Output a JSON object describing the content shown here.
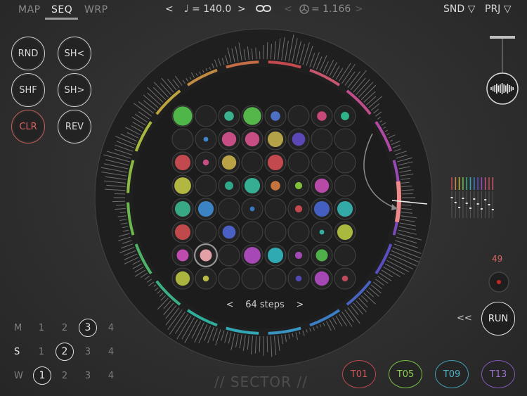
{
  "tabs": {
    "map": "MAP",
    "seq": "SEQ",
    "wrp": "WRP"
  },
  "tempo": {
    "prev": "<",
    "value": "♩ = 140.0",
    "next": ">"
  },
  "swing": {
    "prev": "<",
    "value": "= 1.166",
    "next": ">"
  },
  "menus": {
    "snd": "SND ▽",
    "prj": "PRJ ▽"
  },
  "edit_buttons": {
    "rnd": "RND",
    "shl": "SH<",
    "shf": "SHF",
    "shr": "SH>",
    "clr": "CLR",
    "rev": "REV"
  },
  "modes": {
    "m": {
      "letter": "M",
      "n1": "1",
      "n2": "2",
      "n3": "3",
      "n4": "4"
    },
    "s": {
      "letter": "S",
      "n1": "1",
      "n2": "2",
      "n3": "3",
      "n4": "4"
    },
    "w": {
      "letter": "W",
      "n1": "1",
      "n2": "2",
      "n3": "3",
      "n4": "4"
    }
  },
  "steps": {
    "prev": "<",
    "label": "64 steps",
    "next": ">"
  },
  "brand": "// SECTOR //",
  "counter": "49",
  "rewind": "<<",
  "run": "RUN",
  "tracks": {
    "t1": "T01",
    "t5": "T05",
    "t9": "T09",
    "t13": "T13"
  },
  "colors": {
    "accent_red": "#c95b5b",
    "t1": "#c0494c",
    "t5": "#7bbf43",
    "t9": "#3f9eb3",
    "t13": "#8257b8"
  },
  "grid": [
    [
      [
        "#4fb64a",
        16
      ],
      [
        0,
        0
      ],
      [
        "#3bb08f",
        8
      ],
      [
        "#55b64a",
        15
      ],
      [
        "#4d6fc4",
        8
      ],
      [
        0,
        0
      ],
      [
        "#c9487a",
        8
      ],
      [
        "#2fb48a",
        7
      ]
    ],
    [
      [
        0,
        0
      ],
      [
        "#3f86c9",
        4
      ],
      [
        "#c64e84",
        12
      ],
      [
        "#c64e84",
        12
      ],
      [
        "#b3a247",
        13
      ],
      [
        "#5b47b6",
        11
      ],
      [
        0,
        0
      ],
      [
        0,
        0
      ]
    ],
    [
      [
        "#c24a4e",
        13
      ],
      [
        "#c64e84",
        5
      ],
      [
        "#b9a346",
        12
      ],
      [
        0,
        0
      ],
      [
        "#c2494e",
        13
      ],
      [
        0,
        0
      ],
      [
        0,
        0
      ],
      [
        0,
        0
      ]
    ],
    [
      [
        "#b2b742",
        14
      ],
      [
        0,
        0
      ],
      [
        "#2fa987",
        7
      ],
      [
        "#36ae93",
        13
      ],
      [
        "#c3733d",
        8
      ],
      [
        "#7fbf3b",
        6
      ],
      [
        "#b74aa7",
        12
      ],
      [
        0,
        0
      ]
    ],
    [
      [
        "#39a885",
        13
      ],
      [
        "#3b83c4",
        13
      ],
      [
        0,
        0
      ],
      [
        "#3a78c1",
        4
      ],
      [
        0,
        0
      ],
      [
        "#c24a4e",
        6
      ],
      [
        "#4360c0",
        13
      ],
      [
        "#33a9a8",
        13
      ]
    ],
    [
      [
        "#c04a4b",
        13
      ],
      [
        0,
        0
      ],
      [
        "#4a60c4",
        11
      ],
      [
        0,
        0
      ],
      [
        0,
        0
      ],
      [
        0,
        0
      ],
      [
        "#2fb0a2",
        4
      ],
      [
        "#a8b93e",
        13
      ]
    ],
    [
      [
        "#be4bae",
        10
      ],
      [
        "#e3a0a6",
        10
      ],
      [
        0,
        0
      ],
      [
        "#a648b6",
        14
      ],
      [
        "#2faab2",
        13
      ],
      [
        "#a14ab6",
        6
      ],
      [
        "#4faf4a",
        10
      ],
      [
        0,
        0
      ]
    ],
    [
      [
        "#acb440",
        12
      ],
      [
        "#b8b942",
        5
      ],
      [
        0,
        0
      ],
      [
        0,
        0
      ],
      [
        0,
        0
      ],
      [
        "#5248b8",
        5
      ],
      [
        "#a547b5",
        12
      ],
      [
        "#c2495c",
        5
      ]
    ]
  ]
}
